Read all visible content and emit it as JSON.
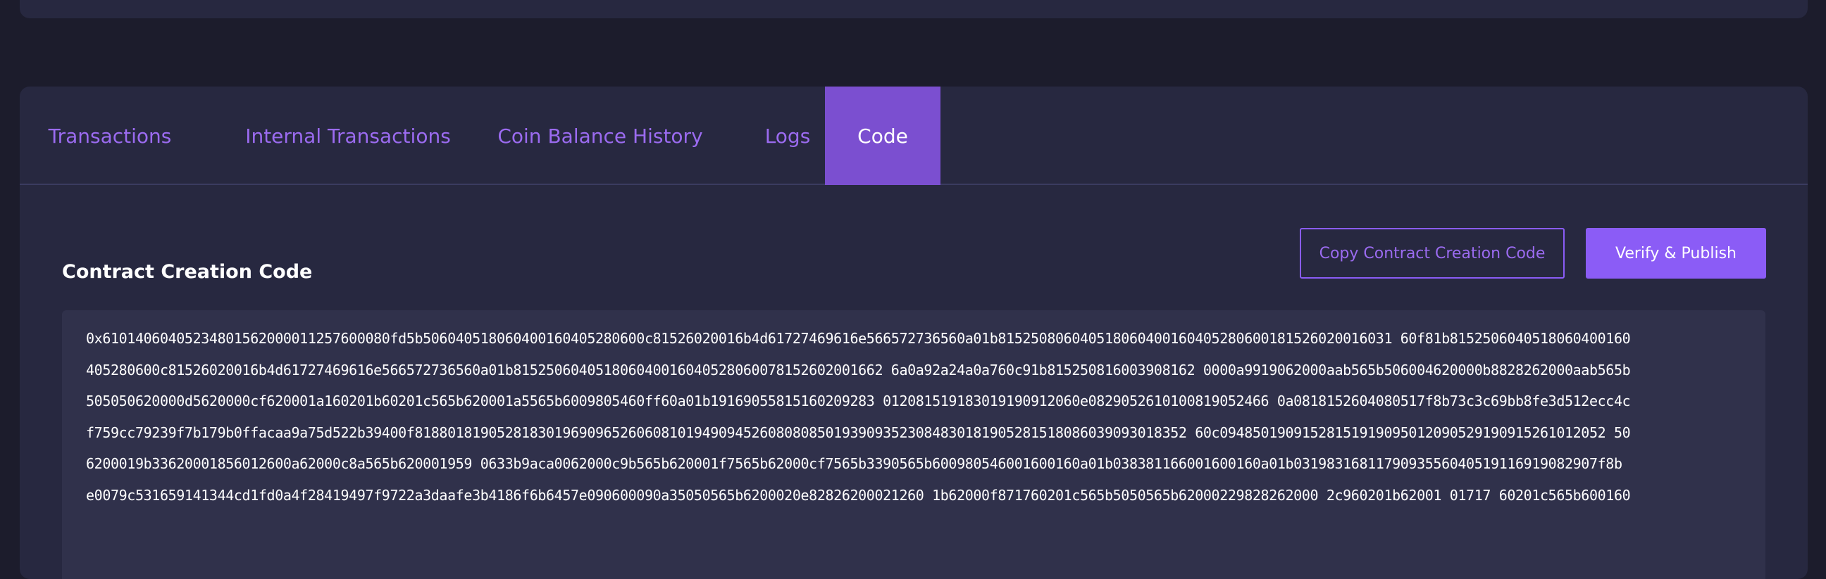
{
  "tabs": [
    {
      "label": "Transactions",
      "active": false
    },
    {
      "label": "Internal Transactions",
      "active": false
    },
    {
      "label": "Coin Balance History",
      "active": false
    },
    {
      "label": "Logs",
      "active": false
    },
    {
      "label": "Code",
      "active": true
    }
  ],
  "section": {
    "title": "Contract Creation Code",
    "copy_button_label": "Copy Contract Creation Code",
    "verify_button_label": "Verify & Publish"
  },
  "code_lines": [
    "0x61014060405234801562000011257600080fd5b506040518060400160405280600c81526020016b4d61727469616e566572736560a01b815250806040518060400160405280600181526020016031 60f81b8152506040518060400160",
    "405280600c81526020016b4d61727469616e566572736560a01b815250604051806040016040528060078152602001662 6a0a92a24a0a760c91b815250816003908162 0000a9919062000aab565b506004620000b8828262000aab565b",
    "505050620000d5620000cf620001a160201b60201c565b620001a5565b6009805460ff60a01b19169055815160209283 012081519183019190912060e0829052610100819052466 0a0818152604080517f8b73c3c69bb8fe3d512ecc4c",
    "f759cc79239f7b179b0ffacaa9a75d522b39400f8188018190528183019690965260608101949094526080808501939093523084830181905281518086039093018352 60c09485019091528151919095012090529190915261012052 50",
    "6200019b33620001856012600a62000c8a565b620001959 0633b9aca0062000c9b565b620001f7565b62000cf7565b3390565b600980546001600160a01b038381166001600160a01b0319831681179093556040519116919082907f8b",
    "e0079c531659141344cd1fd0a4f28419497f9722a3daafe3b4186f6b6457e090600090a35050565b6200020e82826200021260 1b62000f871760201c565b5050565b62000229828262000 2c960201b62001 01717 60201c565b600160"
  ]
}
